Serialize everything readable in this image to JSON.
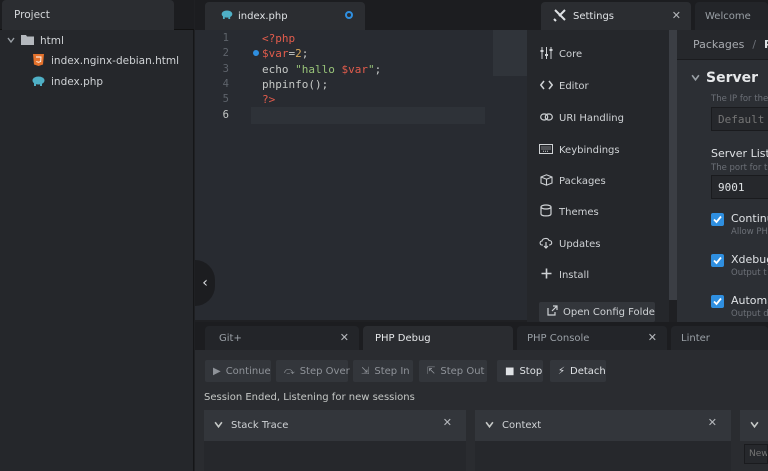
{
  "project": {
    "tab_label": "Project",
    "tree": [
      {
        "label": "html",
        "icon": "folder-icon"
      },
      {
        "label": "index.nginx-debian.html",
        "icon": "html5-icon"
      },
      {
        "label": "index.php",
        "icon": "php-elephant-icon"
      }
    ]
  },
  "tabs": [
    {
      "label": "index.php",
      "icon": "php-elephant-icon",
      "modified": true
    },
    {
      "label": "Settings",
      "icon": "tools-icon"
    },
    {
      "label": "Welcome"
    }
  ],
  "editor": {
    "line_numbers": [
      "1",
      "2",
      "3",
      "4",
      "5",
      "6"
    ],
    "lines": [
      [
        {
          "t": "<?php",
          "c": "#e25c4c"
        }
      ],
      [
        {
          "t": "$var",
          "c": "#e25c4c"
        },
        {
          "t": "=",
          "c": "#c5c8c6"
        },
        {
          "t": "2",
          "c": "#d7a858"
        },
        {
          "t": ";",
          "c": "#c5c8c6"
        }
      ],
      [
        {
          "t": "echo ",
          "c": "#c5c8c6"
        },
        {
          "t": "\"hallo ",
          "c": "#98c379"
        },
        {
          "t": "$var",
          "c": "#e25c4c"
        },
        {
          "t": "\"",
          "c": "#98c379"
        },
        {
          "t": ";",
          "c": "#c5c8c6"
        }
      ],
      [
        {
          "t": "phpinfo",
          "c": "#c5c8c6"
        },
        {
          "t": "()",
          "c": "#c5c8c6"
        },
        {
          "t": ";",
          "c": "#c5c8c6"
        }
      ],
      [
        {
          "t": "?>",
          "c": "#e25c4c"
        }
      ],
      []
    ],
    "breakpoint_line": 2
  },
  "settings_nav": [
    {
      "label": "Core",
      "icon": "sliders-icon"
    },
    {
      "label": "Editor",
      "icon": "code-icon"
    },
    {
      "label": "URI Handling",
      "icon": "link-icon"
    },
    {
      "label": "Keybindings",
      "icon": "keyboard-icon"
    },
    {
      "label": "Packages",
      "icon": "package-icon"
    },
    {
      "label": "Themes",
      "icon": "paintcan-icon"
    },
    {
      "label": "Updates",
      "icon": "cloud-download-icon"
    },
    {
      "label": "Install",
      "icon": "plus-icon"
    }
  ],
  "settings_button": {
    "label": "Open Config Folder",
    "icon": "external-link-icon"
  },
  "settings_panel": {
    "breadcrumb": [
      "Packages",
      "/",
      "Ph"
    ],
    "section_title": "Server",
    "fields": [
      {
        "label": "",
        "hint": "The IP for the",
        "value": "",
        "placeholder": "Default"
      },
      {
        "label": "Server Liste",
        "hint": "The port for t",
        "value": "9001"
      }
    ],
    "checkboxes": [
      {
        "label": "Continu",
        "hint": "Allow PH",
        "checked": true
      },
      {
        "label": "Xdebug",
        "hint": "Output t",
        "checked": true
      },
      {
        "label": "Automa",
        "hint": "Output d",
        "checked": true
      }
    ]
  },
  "bottom_tabs": [
    {
      "label": "Git+"
    },
    {
      "label": "PHP Debug"
    },
    {
      "label": "PHP Console"
    },
    {
      "label": "Linter"
    }
  ],
  "debug": {
    "buttons": [
      {
        "label": "Continue",
        "icon": "play-icon",
        "enabled": false
      },
      {
        "label": "Step Over",
        "icon": "step-over-icon",
        "enabled": false
      },
      {
        "label": "Step In",
        "icon": "step-in-icon",
        "enabled": false
      },
      {
        "label": "Step Out",
        "icon": "step-out-icon",
        "enabled": false
      },
      {
        "label": "Stop",
        "icon": "stop-icon",
        "enabled": true
      },
      {
        "label": "Detach",
        "icon": "zap-icon",
        "enabled": true
      }
    ],
    "status": "Session Ended, Listening for new sessions",
    "panels": [
      {
        "label": "Stack Trace"
      },
      {
        "label": "Context"
      },
      {
        "label": ""
      }
    ],
    "input_placeholder": "New"
  },
  "colors": {
    "accent": "#2f8fe0",
    "background": "#1f2023",
    "editor_bg": "#282b31"
  }
}
